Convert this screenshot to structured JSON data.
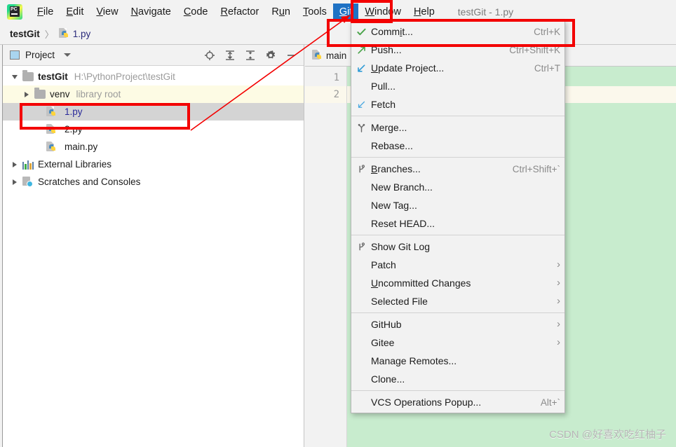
{
  "window": {
    "title": "testGit - 1.py",
    "app_icon": "pycharm-logo-icon"
  },
  "menubar": {
    "items": [
      {
        "label": "File",
        "mnemonic": "F",
        "selected": false
      },
      {
        "label": "Edit",
        "mnemonic": "E",
        "selected": false
      },
      {
        "label": "View",
        "mnemonic": "V",
        "selected": false
      },
      {
        "label": "Navigate",
        "mnemonic": "N",
        "selected": false
      },
      {
        "label": "Code",
        "mnemonic": "C",
        "selected": false
      },
      {
        "label": "Refactor",
        "mnemonic": "R",
        "selected": false
      },
      {
        "label": "Run",
        "mnemonic": "u",
        "selected": false
      },
      {
        "label": "Tools",
        "mnemonic": "T",
        "selected": false
      },
      {
        "label": "Git",
        "mnemonic": "G",
        "selected": true
      },
      {
        "label": "Window",
        "mnemonic": "W",
        "selected": false
      },
      {
        "label": "Help",
        "mnemonic": "H",
        "selected": false
      }
    ]
  },
  "breadcrumb": {
    "project": "testGit",
    "separator": "〉",
    "file": "1.py"
  },
  "project_panel": {
    "title": "Project",
    "panel_icon": "project-window-icon",
    "dropdown_icon": "chevron-down-icon",
    "toolbar_icons": [
      "locate-target-icon",
      "expand-all-icon",
      "collapse-all-icon",
      "settings-gear-icon",
      "hide-minimize-icon"
    ],
    "tree": [
      {
        "label": "testGit",
        "detail": "H:\\PythonProject\\testGit",
        "icon": "folder-icon",
        "expanded": true,
        "indent": 0,
        "bold": true,
        "state": "normal"
      },
      {
        "label": "venv",
        "detail": "library root",
        "icon": "folder-icon",
        "expanded": false,
        "indent": 1,
        "bold": false,
        "state": "folder-highlight"
      },
      {
        "label": "1.py",
        "detail": "",
        "icon": "python-file-icon",
        "indent": 2,
        "bold": false,
        "state": "selected"
      },
      {
        "label": "2.py",
        "detail": "",
        "icon": "python-file-icon",
        "indent": 2,
        "bold": false,
        "state": "normal"
      },
      {
        "label": "main.py",
        "detail": "",
        "icon": "python-file-icon",
        "indent": 2,
        "bold": false,
        "state": "normal"
      },
      {
        "label": "External Libraries",
        "detail": "",
        "icon": "external-libraries-icon",
        "expanded": false,
        "indent": 0,
        "bold": false,
        "state": "normal"
      },
      {
        "label": "Scratches and Consoles",
        "detail": "",
        "icon": "scratches-icon",
        "expanded": false,
        "indent": 0,
        "bold": false,
        "state": "normal"
      }
    ]
  },
  "editor": {
    "tab_label": "main",
    "tab_icon": "python-file-icon",
    "line_numbers": [
      "1",
      "2"
    ],
    "current_line": 2,
    "background_color": "#c8ecce",
    "current_line_color": "#fbf8ec",
    "watermark": "CSDN @好喜欢吃红柚子"
  },
  "git_menu": {
    "groups": [
      {
        "items": [
          {
            "label": "Commit...",
            "mnemonic": "i",
            "shortcut": "Ctrl+K",
            "icon": "commit-check-icon",
            "submenu": false,
            "highlighted": true
          },
          {
            "label": "Push...",
            "mnemonic": "",
            "shortcut": "Ctrl+Shift+K",
            "icon": "push-arrow-icon",
            "submenu": false,
            "highlighted": false
          },
          {
            "label": "Update Project...",
            "mnemonic": "U",
            "shortcut": "Ctrl+T",
            "icon": "update-arrow-icon",
            "submenu": false,
            "highlighted": false
          },
          {
            "label": "Pull...",
            "mnemonic": "",
            "shortcut": "",
            "icon": "",
            "submenu": false,
            "highlighted": false
          },
          {
            "label": "Fetch",
            "mnemonic": "",
            "shortcut": "",
            "icon": "fetch-arrow-icon",
            "submenu": false,
            "highlighted": false
          }
        ]
      },
      {
        "items": [
          {
            "label": "Merge...",
            "mnemonic": "",
            "shortcut": "",
            "icon": "merge-icon",
            "submenu": false,
            "highlighted": false
          },
          {
            "label": "Rebase...",
            "mnemonic": "",
            "shortcut": "",
            "icon": "",
            "submenu": false,
            "highlighted": false
          }
        ]
      },
      {
        "items": [
          {
            "label": "Branches...",
            "mnemonic": "B",
            "shortcut": "Ctrl+Shift+`",
            "icon": "branch-icon",
            "submenu": false,
            "highlighted": false
          },
          {
            "label": "New Branch...",
            "mnemonic": "",
            "shortcut": "",
            "icon": "",
            "submenu": false,
            "highlighted": false
          },
          {
            "label": "New Tag...",
            "mnemonic": "",
            "shortcut": "",
            "icon": "",
            "submenu": false,
            "highlighted": false
          },
          {
            "label": "Reset HEAD...",
            "mnemonic": "",
            "shortcut": "",
            "icon": "",
            "submenu": false,
            "highlighted": false
          }
        ]
      },
      {
        "items": [
          {
            "label": "Show Git Log",
            "mnemonic": "",
            "shortcut": "",
            "icon": "branch-icon",
            "submenu": false,
            "highlighted": false
          },
          {
            "label": "Patch",
            "mnemonic": "",
            "shortcut": "",
            "icon": "",
            "submenu": true,
            "highlighted": false
          },
          {
            "label": "Uncommitted Changes",
            "mnemonic": "U",
            "shortcut": "",
            "icon": "",
            "submenu": true,
            "highlighted": false
          },
          {
            "label": "Selected File",
            "mnemonic": "",
            "shortcut": "",
            "icon": "",
            "submenu": true,
            "highlighted": false
          }
        ]
      },
      {
        "items": [
          {
            "label": "GitHub",
            "mnemonic": "",
            "shortcut": "",
            "icon": "",
            "submenu": true,
            "highlighted": false
          },
          {
            "label": "Gitee",
            "mnemonic": "",
            "shortcut": "",
            "icon": "",
            "submenu": true,
            "highlighted": false
          },
          {
            "label": "Manage Remotes...",
            "mnemonic": "",
            "shortcut": "",
            "icon": "",
            "submenu": false,
            "highlighted": false
          },
          {
            "label": "Clone...",
            "mnemonic": "",
            "shortcut": "",
            "icon": "",
            "submenu": false,
            "highlighted": false
          }
        ]
      },
      {
        "items": [
          {
            "label": "VCS Operations Popup...",
            "mnemonic": "",
            "shortcut": "Alt+`",
            "icon": "",
            "submenu": false,
            "highlighted": false
          }
        ]
      }
    ]
  },
  "annotations": {
    "color": "#f30000",
    "boxes": [
      "git-menu-title-highlight",
      "commit-item-highlight",
      "file-1py-highlight"
    ],
    "arrow": "red-arrow-from-file-to-git-menu"
  }
}
